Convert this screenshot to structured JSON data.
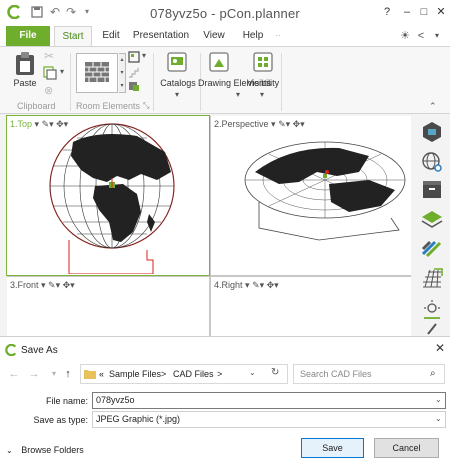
{
  "window": {
    "title": "078yvz5o - pCon.planner",
    "help": "?",
    "minimize": "–",
    "maximize": "□",
    "close": "✕"
  },
  "tabs": [
    "File",
    "Start",
    "Edit",
    "Presentation",
    "View",
    "Help"
  ],
  "ribbon": {
    "paste": "Paste",
    "clipboard_group": "Clipboard",
    "room_elements_group": "Room Elements",
    "catalogs": "Catalogs",
    "drawing_elements": "Drawing Elements",
    "visibility": "Visibility"
  },
  "viewports": [
    {
      "label": "1.Top",
      "active": true
    },
    {
      "label": "2.Perspective",
      "active": false
    },
    {
      "label": "3.Front",
      "active": false
    },
    {
      "label": "4.Right",
      "active": false
    }
  ],
  "dialog": {
    "title": "Save As",
    "breadcrumb": [
      "«",
      "Sample Files",
      ">",
      "CAD Files",
      ">"
    ],
    "search_placeholder": "Search CAD Files",
    "file_name_label": "File name:",
    "file_name_value": "078yvz5o",
    "save_as_type_label": "Save as type:",
    "save_as_type_value": "JPEG Graphic (*.jpg)",
    "browse_folders": "Browse Folders",
    "save": "Save",
    "cancel": "Cancel"
  },
  "colors": {
    "accent_green": "#6fae2d",
    "active_viewport": "#7ab23c",
    "primary_button_border": "#0078d7",
    "globe_outline": "#d9251c"
  }
}
